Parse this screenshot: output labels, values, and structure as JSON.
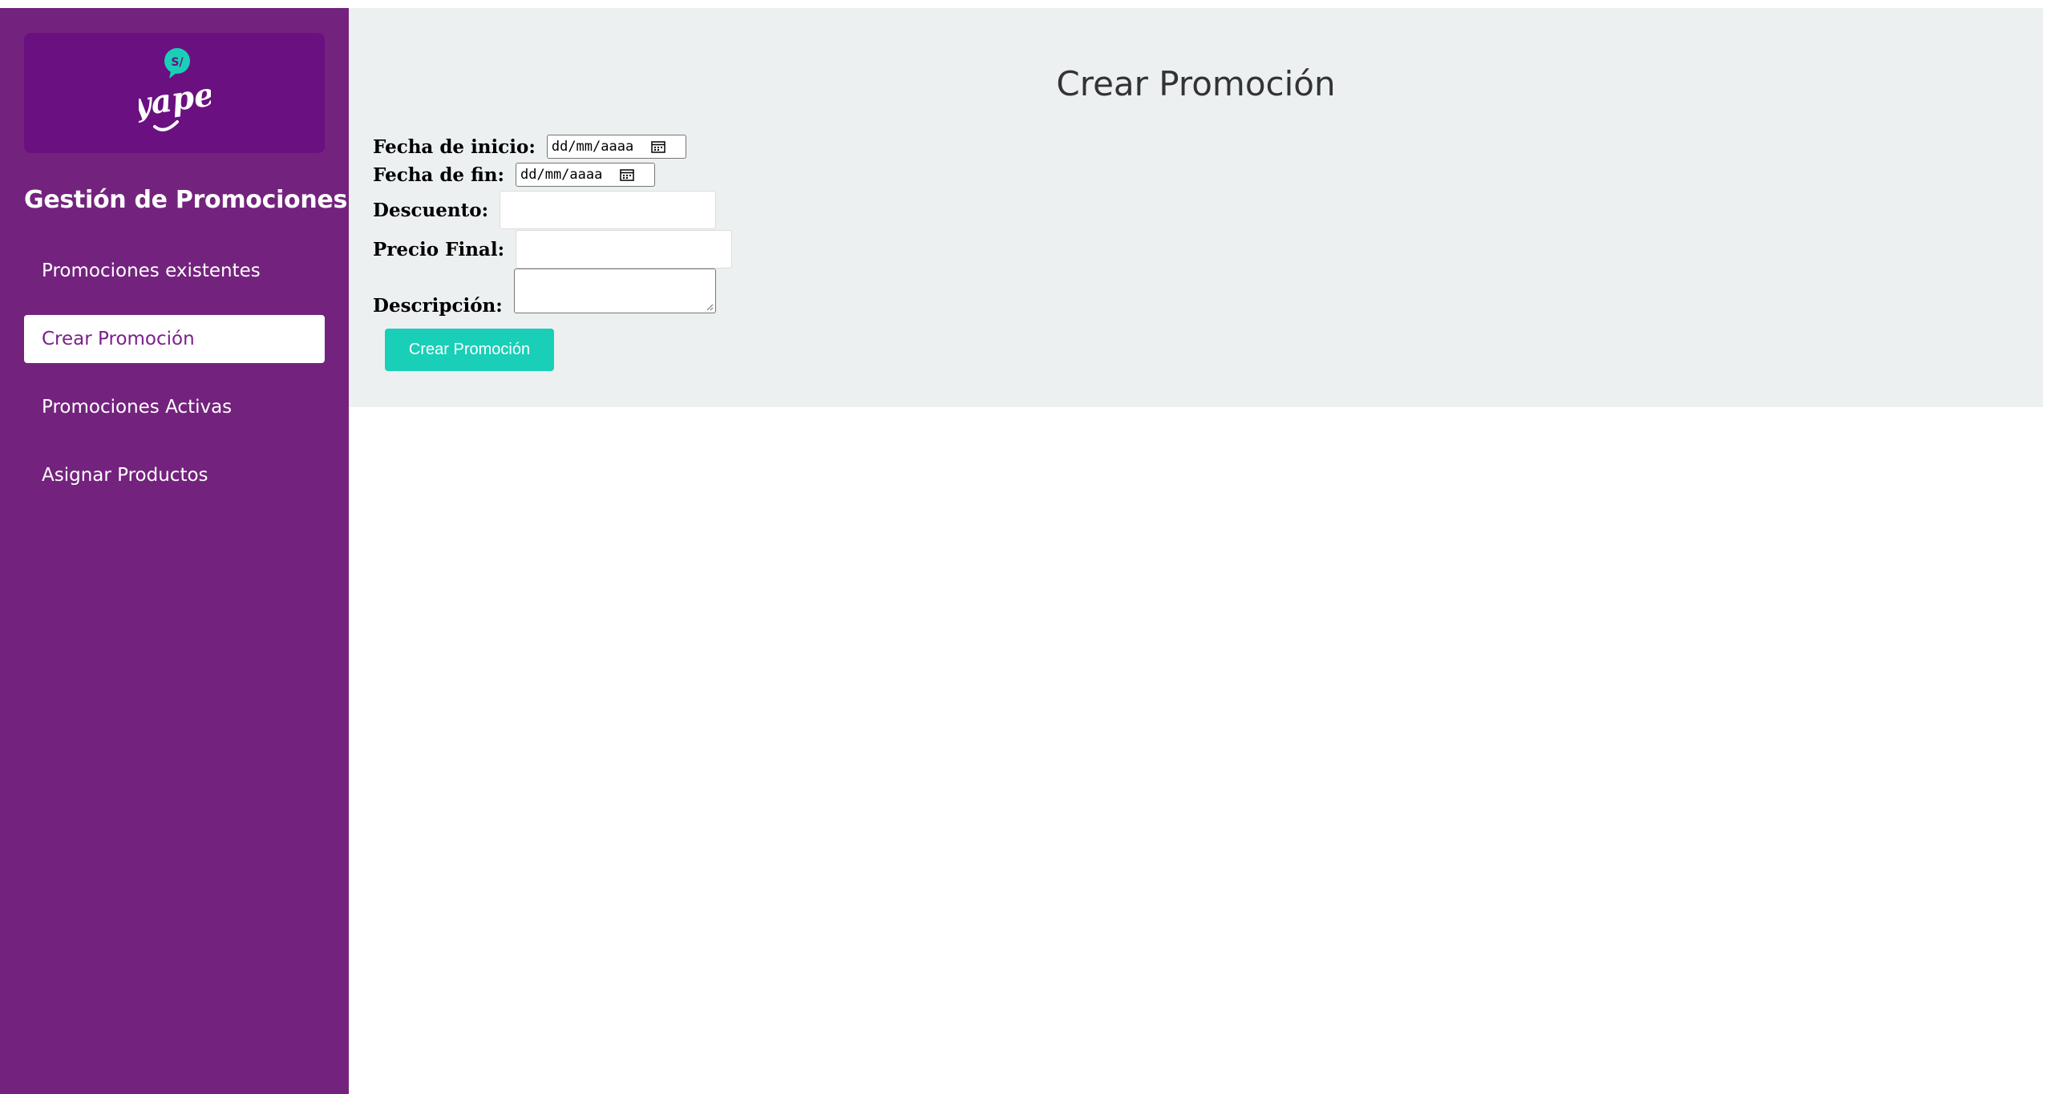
{
  "brand": {
    "logo_text": "yape",
    "logo_badge": "S/"
  },
  "sidebar": {
    "title": "Gestión de Promociones",
    "items": [
      {
        "label": "Promociones existentes",
        "active": false
      },
      {
        "label": "Crear Promoción",
        "active": true
      },
      {
        "label": "Promociones Activas",
        "active": false
      },
      {
        "label": "Asignar Productos",
        "active": false
      }
    ]
  },
  "main": {
    "title": "Crear Promoción",
    "form": {
      "start_date_label": "Fecha de inicio:",
      "start_date_value": "dd/mm/aaaa",
      "end_date_label": "Fecha de fin:",
      "end_date_value": "dd/mm/aaaa",
      "discount_label": "Descuento:",
      "discount_value": "",
      "final_price_label": "Precio Final:",
      "final_price_value": "",
      "description_label": "Descripción:",
      "description_value": "",
      "submit_label": "Crear Promoción"
    }
  },
  "colors": {
    "sidebar_bg": "#73237d",
    "logo_bg": "#6b1080",
    "accent": "#1acfb7",
    "panel_bg": "#ecf0f1",
    "active_text": "#7b1f8c"
  }
}
